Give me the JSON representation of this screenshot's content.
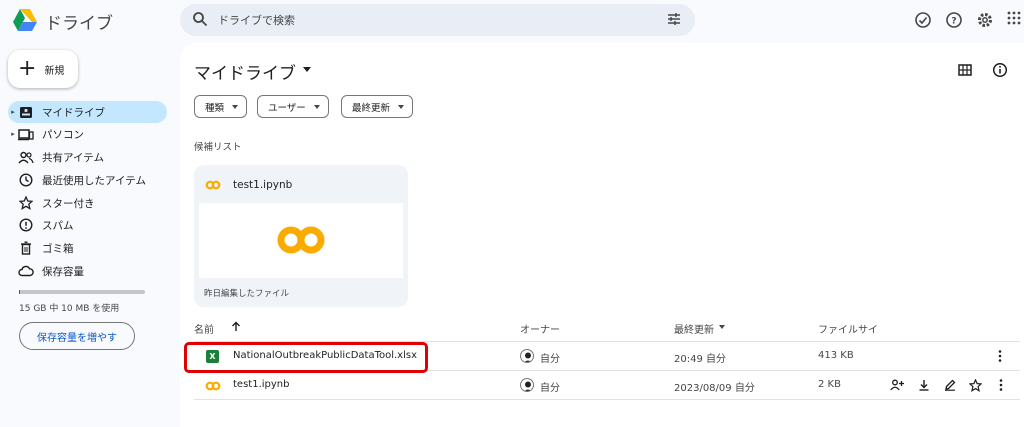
{
  "app": {
    "title": "ドライブ"
  },
  "search": {
    "placeholder": "ドライブで検索"
  },
  "sidebar": {
    "new_label": "新規",
    "items": [
      {
        "label": "マイドライブ"
      },
      {
        "label": "パソコン"
      },
      {
        "label": "共有アイテム"
      },
      {
        "label": "最近使用したアイテム"
      },
      {
        "label": "スター付き"
      },
      {
        "label": "スパム"
      },
      {
        "label": "ゴミ箱"
      },
      {
        "label": "保存容量"
      }
    ],
    "storage_text": "15 GB 中 10 MB を使用",
    "storage_used_fraction": 0.0007,
    "storage_button": "保存容量を増やす"
  },
  "main": {
    "title": "マイドライブ",
    "filters": [
      "種類",
      "ユーザー",
      "最終更新"
    ],
    "suggested_label": "候補リスト",
    "suggested": {
      "name": "test1.ipynb",
      "subtitle": "昨日編集したファイル"
    },
    "columns": {
      "name": "名前",
      "owner": "オーナー",
      "modified": "最終更新",
      "size": "ファイルサイ"
    },
    "files": [
      {
        "name": "NationalOutbreakPublicDataTool.xlsx",
        "owner": "自分",
        "modified": "20:49 自分",
        "size": "413 KB",
        "icon": "excel-icon"
      },
      {
        "name": "test1.ipynb",
        "owner": "自分",
        "modified": "2023/08/09 自分",
        "size": "2 KB",
        "icon": "colab-icon"
      }
    ]
  },
  "colors": {
    "active_nav": "#c2e7ff",
    "highlight": "#e00000",
    "colab": "#f9ab00",
    "excel": "#188038"
  }
}
